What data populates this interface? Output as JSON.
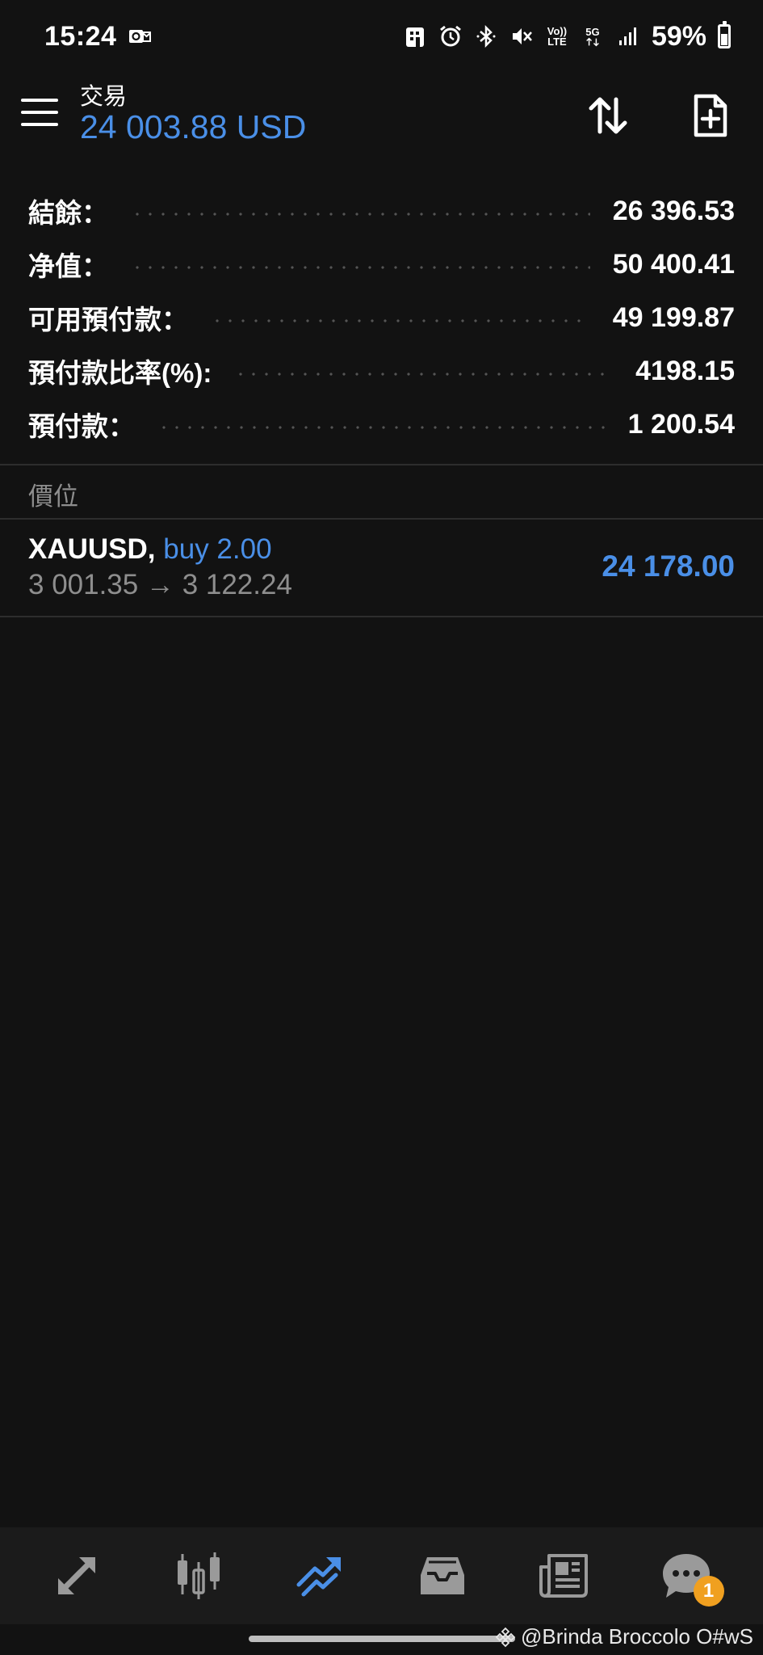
{
  "status_bar": {
    "time": "15:24",
    "battery_percent": "59%",
    "network_5g": "5G",
    "volte_top": "Vo))",
    "volte_bottom": "LTE",
    "icons": [
      "outlook-icon",
      "parking-icon",
      "alarm-icon",
      "bluetooth-icon",
      "mute-icon",
      "volte-icon",
      "5g-icon",
      "signal-icon",
      "battery-icon"
    ]
  },
  "header": {
    "title": "交易",
    "balance": "24 003.88 USD"
  },
  "summary": {
    "rows": [
      {
        "label": "結餘：",
        "value": "26 396.53"
      },
      {
        "label": "净值：",
        "value": "50 400.41"
      },
      {
        "label": "可用預付款：",
        "value": "49 199.87"
      },
      {
        "label": "預付款比率(%):",
        "value": "4198.15"
      },
      {
        "label": "預付款：",
        "value": "1 200.54"
      }
    ]
  },
  "positions": {
    "section_title": "價位",
    "items": [
      {
        "symbol": "XAUUSD,",
        "type": "buy 2.00",
        "prices": "3 001.35 → 3 122.24",
        "profit": "24 178.00"
      }
    ]
  },
  "bottom_nav": {
    "items": [
      {
        "name": "quotes",
        "icon": "arrows-diagonal-icon",
        "active": false
      },
      {
        "name": "charts",
        "icon": "candlestick-icon",
        "active": false
      },
      {
        "name": "trade",
        "icon": "trend-up-icon",
        "active": true
      },
      {
        "name": "history",
        "icon": "inbox-icon",
        "active": false
      },
      {
        "name": "news",
        "icon": "newspaper-icon",
        "active": false
      },
      {
        "name": "messages",
        "icon": "chat-icon",
        "active": false,
        "badge": "1"
      }
    ]
  },
  "watermark": "@Brinda Broccolo O#wS",
  "colors": {
    "background": "#121212",
    "accent": "#4a8fe7",
    "muted": "#8e8e8e",
    "badge": "#f0a020"
  }
}
